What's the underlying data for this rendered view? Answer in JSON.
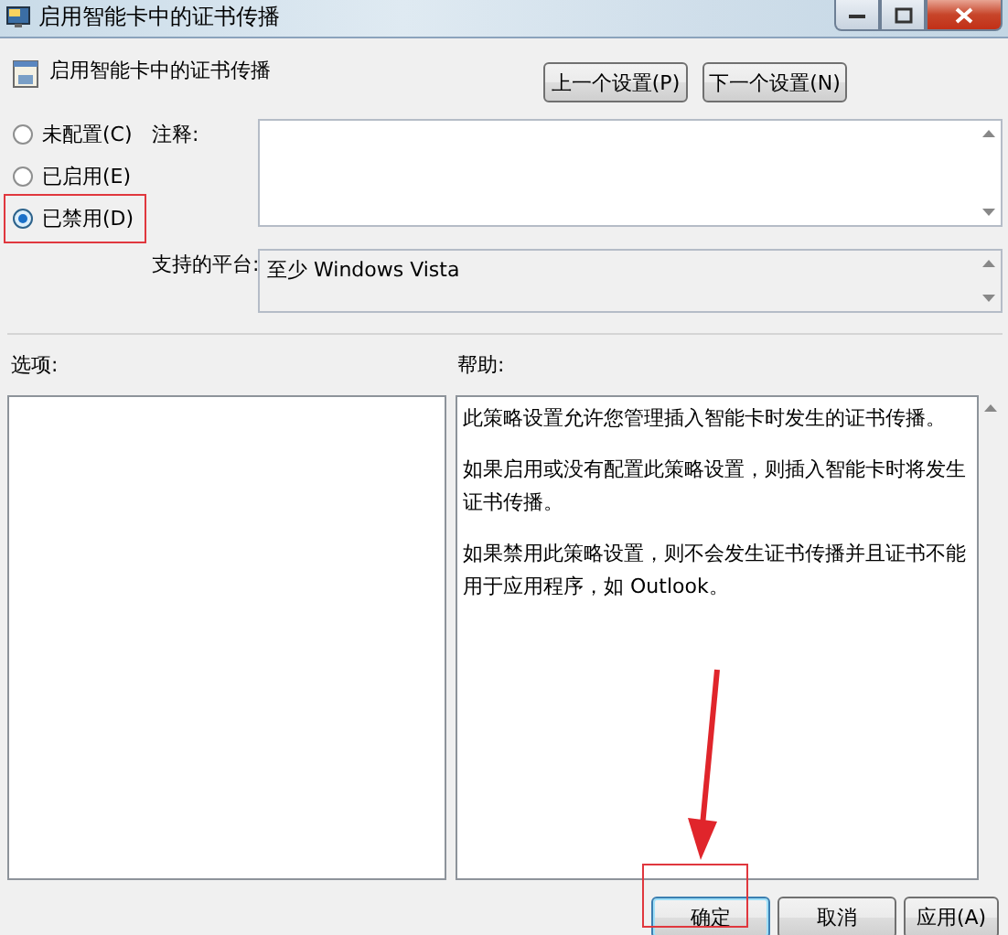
{
  "window": {
    "title": "启用智能卡中的证书传播"
  },
  "header": {
    "title": "启用智能卡中的证书传播",
    "buttons": [
      "上一个设置(P)",
      "下一个设置(N)"
    ]
  },
  "options": [
    {
      "label": "未配置(C)",
      "selected": false
    },
    {
      "label": "已启用(E)",
      "selected": false
    },
    {
      "label": "已禁用(D)",
      "selected": true
    }
  ],
  "comment": {
    "label": "注释:"
  },
  "platform": {
    "label": "支持的平台:",
    "value": "至少 Windows Vista"
  },
  "options_panel": {
    "label": "选项:"
  },
  "help": {
    "label": "帮助:",
    "paragraphs": [
      "此策略设置允许您管理插入智能卡时发生的证书传播。",
      "如果启用或没有配置此策略设置，则插入智能卡时将发生证书传播。",
      "如果禁用此策略设置，则不会发生证书传播并且证书不能用于应用程序，如 Outlook。"
    ]
  },
  "buttons": [
    {
      "label": "确定",
      "kind": "default"
    },
    {
      "label": "取消",
      "kind": "normal"
    },
    {
      "label": "应用(A)",
      "kind": "normal"
    }
  ]
}
